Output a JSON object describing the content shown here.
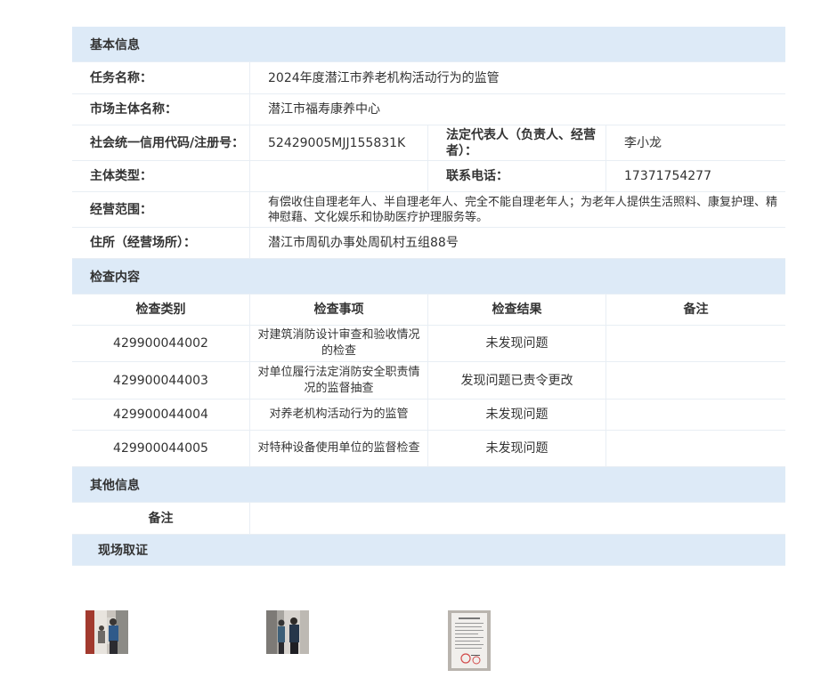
{
  "basic": {
    "title": "基本信息",
    "task_name_label": "任务名称：",
    "task_name": "2024年度潜江市养老机构活动行为的监管",
    "market_subject_label": "市场主体名称：",
    "market_subject": "潜江市福寿康养中心",
    "credit_code_label": "社会统一信用代码/注册号：",
    "credit_code": "52429005MJJ155831K",
    "legal_rep_label": "法定代表人（负责人、经营者）：",
    "legal_rep": "李小龙",
    "subject_type_label": "主体类型：",
    "subject_type": "",
    "phone_label": "联系电话：",
    "phone": "17371754277",
    "scope_label": "经营范围：",
    "scope": "有偿收住自理老年人、半自理老年人、完全不能自理老年人；为老年人提供生活照料、康复护理、精神慰藉、文化娱乐和协助医疗护理服务等。",
    "address_label": "住所（经营场所）：",
    "address": "潜江市周矶办事处周矶村五组88号"
  },
  "inspection": {
    "title": "检查内容",
    "headers": [
      "检查类别",
      "检查事项",
      "检查结果",
      "备注"
    ],
    "rows": [
      {
        "category": "429900044002",
        "item": "对建筑消防设计审查和验收情况的检查",
        "result": "未发现问题",
        "note": ""
      },
      {
        "category": "429900044003",
        "item": "对单位履行法定消防安全职责情况的监督抽查",
        "result": "发现问题已责令更改",
        "note": ""
      },
      {
        "category": "429900044004",
        "item": "对养老机构活动行为的监管",
        "result": "未发现问题",
        "note": ""
      },
      {
        "category": "429900044005",
        "item": "对特种设备使用单位的监督检查",
        "result": "未发现问题",
        "note": ""
      }
    ]
  },
  "other": {
    "title": "其他信息",
    "note_label": "备注",
    "note": ""
  },
  "evidence": {
    "title": "现场取证",
    "photos": [
      "photo-inspection-1",
      "photo-inspection-2",
      "photo-document"
    ]
  }
}
